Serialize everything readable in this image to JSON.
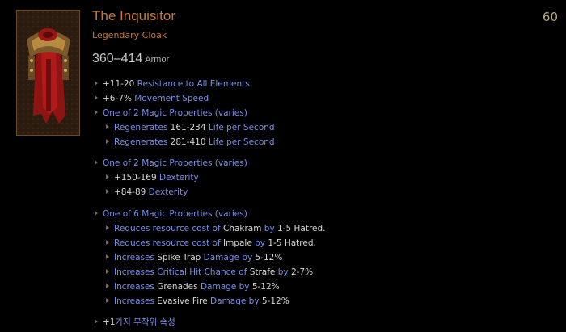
{
  "item": {
    "name": "The Inquisitor",
    "type": "Legendary Cloak",
    "level": "60",
    "armor": {
      "value": "360–414",
      "unit": "Armor"
    },
    "image_name": "cloak-icon"
  },
  "properties": [
    {
      "value": "+11-20",
      "text": " Resistance to All Elements"
    },
    {
      "value": "+6-7%",
      "text": " Movement Speed"
    }
  ],
  "group1": {
    "header": "One of 2 Magic Properties (varies)",
    "items": [
      {
        "pre": "Regenerates ",
        "value": "161-234",
        "post": " Life per Second"
      },
      {
        "pre": "Regenerates ",
        "value": "281-410",
        "post": " Life per Second"
      }
    ]
  },
  "group2": {
    "header": "One of 2 Magic Properties (varies)",
    "items": [
      {
        "value": "+150-169",
        "text": " Dexterity"
      },
      {
        "value": "+84-89",
        "text": " Dexterity"
      }
    ]
  },
  "group3": {
    "header": "One of 6 Magic Properties (varies)",
    "items": [
      {
        "p1": "Reduces resource cost of ",
        "skill": "Chakram",
        "p2": " by ",
        "value": "1-5",
        "p3": " Hatred."
      },
      {
        "p1": "Reduces resource cost of ",
        "skill": "Impale",
        "p2": " by ",
        "value": "1-5",
        "p3": " Hatred."
      },
      {
        "p1": "Increases ",
        "skill": "Spike Trap",
        "p2": " Damage by ",
        "value": "5-12%",
        "p3": ""
      },
      {
        "p1": "Increases Critical Hit Chance of ",
        "skill": "Strafe",
        "p2": " by ",
        "value": "2-7%",
        "p3": ""
      },
      {
        "p1": "Increases ",
        "skill": "Grenades",
        "p2": " Damage by ",
        "value": "5-12%",
        "p3": ""
      },
      {
        "p1": "Increases ",
        "skill": "Evasive Fire",
        "p2": " Damage by ",
        "value": "5-12%",
        "p3": ""
      }
    ]
  },
  "random_property": {
    "value": "+1",
    "text": "가지 무작위 속성"
  },
  "colors": {
    "title": "#c7773a",
    "magic": "#7b8ee8",
    "value": "#d6d6d6"
  }
}
